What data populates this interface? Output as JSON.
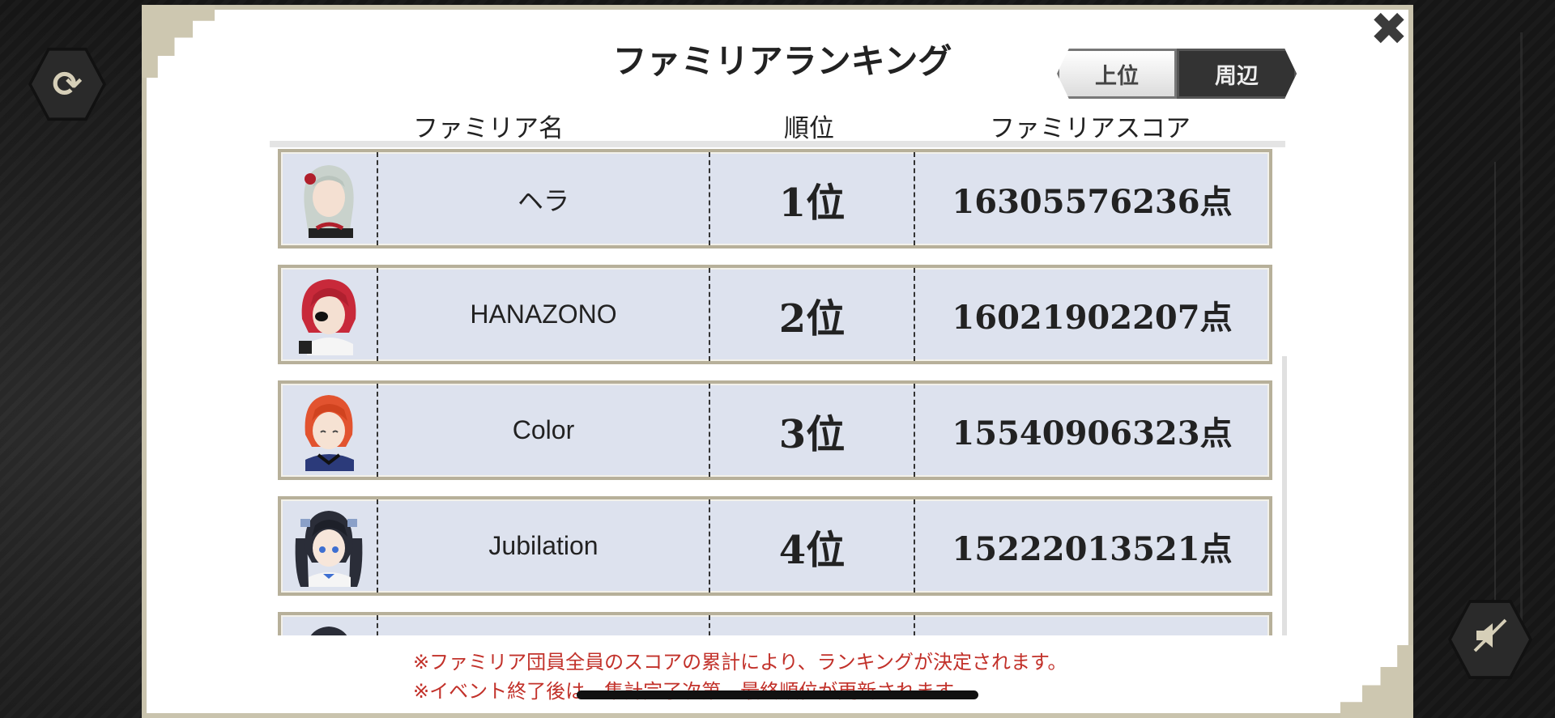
{
  "title": "ファミリアランキング",
  "tabs": [
    {
      "label": "上位",
      "active": false
    },
    {
      "label": "周辺",
      "active": true
    }
  ],
  "headers": {
    "name": "ファミリア名",
    "rank": "順位",
    "score": "ファミリアスコア"
  },
  "rows": [
    {
      "avatar": "character-avatar-silver-hair",
      "hair_color": "#c9d2cc",
      "accent": "#b01f2b",
      "name": "ヘラ",
      "rank": "1位",
      "score": "16305576236点"
    },
    {
      "avatar": "character-avatar-red-hair",
      "hair_color": "#c8293a",
      "accent": "#ffffff",
      "name": "HANAZONO",
      "rank": "2位",
      "score": "16021902207点"
    },
    {
      "avatar": "character-avatar-orange-hair",
      "hair_color": "#e2532f",
      "accent": "#2b3a7a",
      "name": "Color",
      "rank": "3位",
      "score": "15540906323点"
    },
    {
      "avatar": "character-avatar-black-twintails",
      "hair_color": "#2a2d38",
      "accent": "#3e6fd1",
      "name": "Jubilation",
      "rank": "4位",
      "score": "15222013521点"
    },
    {
      "avatar": "character-avatar-partial",
      "hair_color": "#2a2d38",
      "accent": "#9aa",
      "name": "",
      "rank": "",
      "score": ""
    }
  ],
  "notes": [
    "※ファミリア団員全員のスコアの累計により、ランキングが決定されます。",
    "※イベント終了後は、集計完了次第、最終順位が更新されます。"
  ],
  "icons": {
    "refresh": "refresh-icon",
    "close": "close-icon",
    "sound": "sound-off-icon"
  },
  "colors": {
    "row_bg": "#dde2ee",
    "row_border": "#b7b09a",
    "note_text": "#c2312a",
    "active_tab": "#333333"
  }
}
